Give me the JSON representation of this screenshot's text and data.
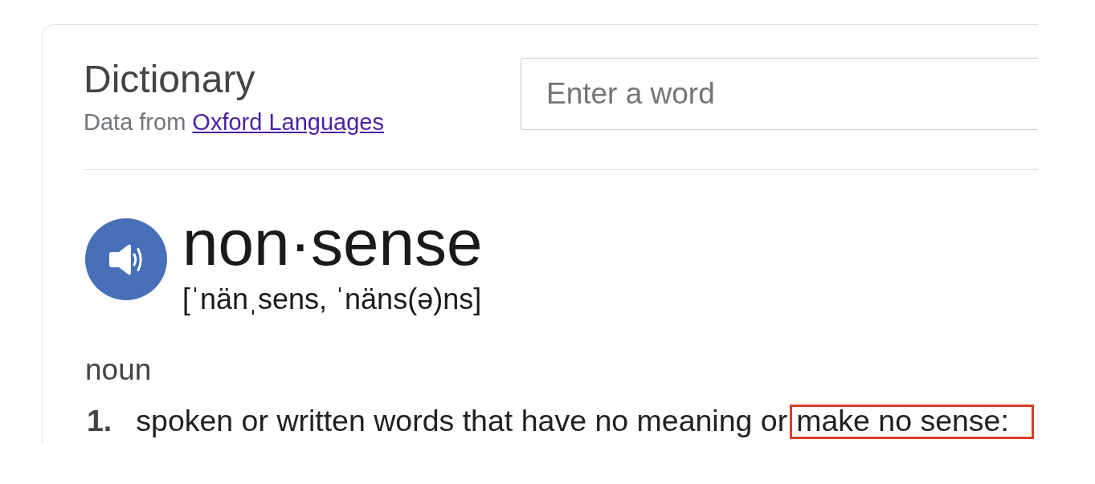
{
  "header": {
    "title": "Dictionary",
    "source_label": "Data from",
    "source_link": "Oxford Languages"
  },
  "search": {
    "placeholder": "Enter a word"
  },
  "entry": {
    "headword": "non·sense",
    "pronunciation": "[ˈnänˌsens, ˈnäns(ə)ns]",
    "part_of_speech": "noun",
    "definitions": [
      {
        "number": "1.",
        "text": "spoken or written words that have no meaning or",
        "highlighted": "make no sense:"
      }
    ]
  }
}
